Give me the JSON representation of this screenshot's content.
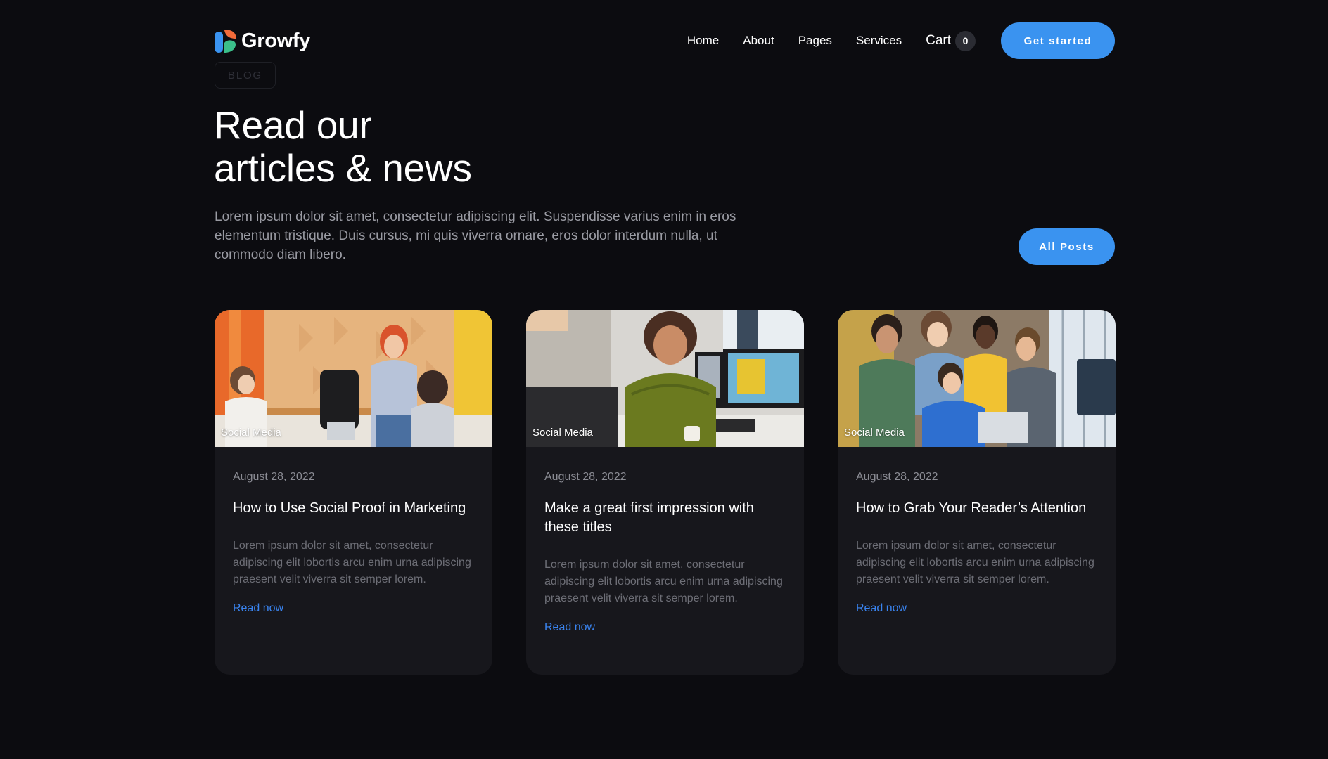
{
  "brand": {
    "name": "Growfy",
    "logo_colors": [
      "#3a93f0",
      "#f26b3a",
      "#3bbf8a"
    ]
  },
  "nav": {
    "links": [
      {
        "label": "Home"
      },
      {
        "label": "About"
      },
      {
        "label": "Pages"
      },
      {
        "label": "Services"
      }
    ],
    "cart_label": "Cart",
    "cart_count": "0",
    "cta_label": "Get started"
  },
  "hero": {
    "tag": "BLOG",
    "title_line1": "Read our",
    "title_line2": "articles & news",
    "description": "Lorem ipsum dolor sit amet, consectetur adipiscing elit. Suspendisse varius enim in eros elementum tristique. Duis cursus, mi quis viverra ornare, eros dolor interdum nulla, ut commodo diam libero.",
    "all_posts_label": "All Posts"
  },
  "posts": [
    {
      "category": "Social Media",
      "date": "August 28, 2022",
      "title": "How to Use Social Proof in Marketing",
      "excerpt": "Lorem ipsum dolor sit amet, consectetur adipiscing elit lobortis arcu enim urna adipiscing praesent velit viverra sit semper lorem.",
      "link_label": "Read now"
    },
    {
      "category": "Social Media",
      "date": "August 28, 2022",
      "title": "Make a great first impression with these titles",
      "excerpt": "Lorem ipsum dolor sit amet, consectetur adipiscing elit lobortis arcu enim urna adipiscing praesent velit viverra sit semper lorem.",
      "link_label": "Read now"
    },
    {
      "category": "Social Media",
      "date": "August 28, 2022",
      "title": "How to Grab Your Reader’s Attention",
      "excerpt": "Lorem ipsum dolor sit amet, consectetur adipiscing elit lobortis arcu enim urna adipiscing praesent velit viverra sit semper lorem.",
      "link_label": "Read now"
    }
  ],
  "colors": {
    "background": "#0c0c10",
    "card": "#17171c",
    "accent": "#3a93f0",
    "link": "#3a84f0"
  }
}
